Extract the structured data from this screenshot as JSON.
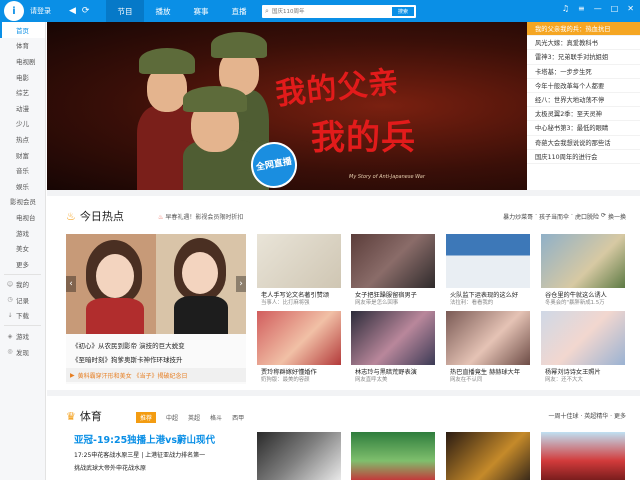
{
  "app": {
    "logo_letter": "i",
    "login": "请登录"
  },
  "nav": {
    "back": "◀",
    "refresh": "⟳"
  },
  "tabs": [
    {
      "label": "节目"
    },
    {
      "label": "播放"
    },
    {
      "label": "赛事"
    },
    {
      "label": "直播"
    }
  ],
  "search": {
    "placeholder": "国庆110周年",
    "button": "搜索"
  },
  "window_controls": {
    "skin": "♫",
    "menu": "≡",
    "min": "—",
    "max": "□",
    "close": "✕"
  },
  "sidebar": {
    "items": [
      "首页",
      "体育",
      "电视剧",
      "电影",
      "综艺",
      "动漫",
      "少儿",
      "热点",
      "财富",
      "音乐",
      "娱乐",
      "影视会员",
      "电视台",
      "游戏",
      "美女",
      "更多"
    ],
    "bottom": [
      {
        "icon": "person-icon",
        "label": "我的"
      },
      {
        "icon": "history-icon",
        "label": "记录"
      },
      {
        "icon": "download-icon",
        "label": "下载"
      },
      {
        "icon": "game-icon",
        "label": "游戏"
      },
      {
        "icon": "discover-icon",
        "label": "发现"
      }
    ]
  },
  "banner": {
    "title_line1": "我的父亲",
    "title_line2": "我的兵",
    "subtitle": "My Story of Anti-Japanese War",
    "badge": "全网直播",
    "list": [
      "我的父亲我的兵：热血抗日",
      "风光大嫁：真爱教科书",
      "雷神3：兄弟联手对抗姐姐",
      "卡塔基：一步步生死",
      "今年十般改革每个人都要",
      "经八：世界大地动荡不停",
      "太极灵翼2季：至天灵神",
      "中心秘书第3：最低的眼睛",
      "奇葩大会我想说说的那些话",
      "国庆110周年的进行会"
    ]
  },
  "hot": {
    "title": "今日热点",
    "promo": "早春礼遇！影视会员限时折扣",
    "keywords": [
      "暴力炒菜哥",
      "孩子当而伞",
      "虎口脱险",
      "换一换"
    ],
    "big": {
      "line1": "《初心》从农民到影帝 演技的巨大蜕变",
      "line2": "《至暗时刻》狗爹奥斯卡神作环球技升",
      "foot": "黄科霸穿汗形和美女 《当子》揭破纪念日"
    },
    "tiles": [
      {
        "cap": "老人手写论文名著引赞颂",
        "sub": "当事人：比打麻将强"
      },
      {
        "cap": "女子把狂躁服留宿男子",
        "sub": "网友带是怎么回事"
      },
      {
        "cap": "火队监下运表现的这么好",
        "sub": "法拉利：看看我的"
      },
      {
        "cap": "谷仓里的牛就这么诱人",
        "sub": "冬奥会的\"暴胖新成1.5万"
      },
      {
        "cap": "贾玲称群嫁好懂婚作",
        "sub": "奶狗版：最美的容颜"
      },
      {
        "cap": "林志玲与黑暗荒野表演",
        "sub": "网友直呼太美"
      },
      {
        "cap": "热巴直播竟生 赫赫球大年",
        "sub": "网友在不认同"
      },
      {
        "cap": "杨幂刘诗诗女王照片",
        "sub": "网友：还不大大"
      }
    ]
  },
  "sports": {
    "title": "体育",
    "subtabs": [
      "推荐",
      "中超",
      "英超",
      "格斗",
      "西甲"
    ],
    "right": "一周十佳球 · 英超精华 · 更多",
    "headline": "亚冠-19:25独播上港vs蔚山现代",
    "line1": "17:25申花客战水原三星 | 上港征亚战力排名第一",
    "line2": "挑战武球大帝外申花战水原"
  },
  "colors": {
    "brand": "#0a8fe6",
    "accent": "#f5a623",
    "banner_red": "#e21b1b"
  }
}
